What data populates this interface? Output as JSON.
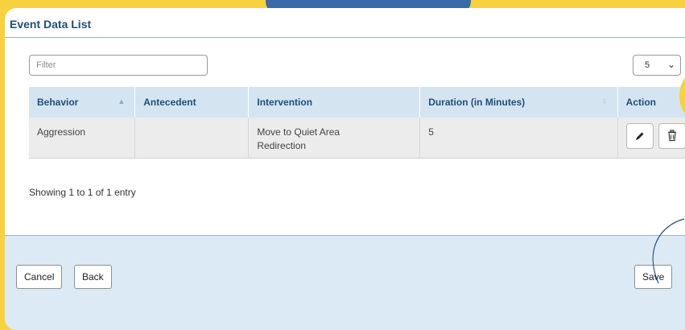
{
  "panel": {
    "title": "Event Data List"
  },
  "filter": {
    "placeholder": "Filter",
    "value": ""
  },
  "page_size": {
    "selected": "5"
  },
  "table": {
    "columns": [
      "Behavior",
      "Antecedent",
      "Intervention",
      "Duration (in Minutes)",
      "Action"
    ],
    "rows": [
      {
        "behavior": "Aggression",
        "antecedent": "",
        "intervention_line1": "Move to Quiet Area",
        "intervention_line2": "Redirection",
        "duration": "5"
      }
    ]
  },
  "info": {
    "text": "Showing 1 to 1 of 1 entry"
  },
  "footer": {
    "cancel_label": "Cancel",
    "back_label": "Back",
    "save_label": "Save"
  },
  "icons": {
    "edit": "pencil-icon",
    "delete": "trash-icon",
    "dropdown": "chevron-down-icon"
  },
  "colors": {
    "background": "#f7d23e",
    "accent": "#1f4e79",
    "header_fill": "#d4e5f1",
    "footer_fill": "#dbeaf4"
  }
}
